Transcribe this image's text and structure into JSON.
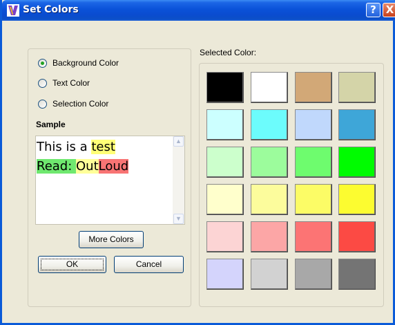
{
  "window": {
    "title": "Set Colors",
    "help_glyph": "?",
    "close_glyph": "X"
  },
  "options": {
    "items": [
      {
        "label": "Background Color",
        "checked": true
      },
      {
        "label": "Text Color",
        "checked": false
      },
      {
        "label": "Selection Color",
        "checked": false
      }
    ]
  },
  "sample": {
    "label": "Sample",
    "line1_plain": "This is a ",
    "line1_selected": "test",
    "line2_part1": "Read: ",
    "line2_part2": "Out",
    "line2_part3": "Loud"
  },
  "buttons": {
    "more_colors": "More Colors",
    "ok": "OK",
    "cancel": "Cancel"
  },
  "palette": {
    "label": "Selected Color:",
    "rows": [
      [
        "#000000",
        "#ffffff",
        "#d2a877",
        "#d4d4a8"
      ],
      [
        "#ccffff",
        "#6cfcfc",
        "#c0d8fc",
        "#3ea6d8"
      ],
      [
        "#ccffcc",
        "#9cfc9c",
        "#6efc6e",
        "#00fc00"
      ],
      [
        "#ffffcc",
        "#fcfc9c",
        "#fcfc66",
        "#fcfc30"
      ],
      [
        "#fcd4d4",
        "#fca6a6",
        "#fc7474",
        "#fc4a44"
      ],
      [
        "#d4d4fc",
        "#d2d2d2",
        "#a8a8a8",
        "#747474"
      ]
    ]
  }
}
